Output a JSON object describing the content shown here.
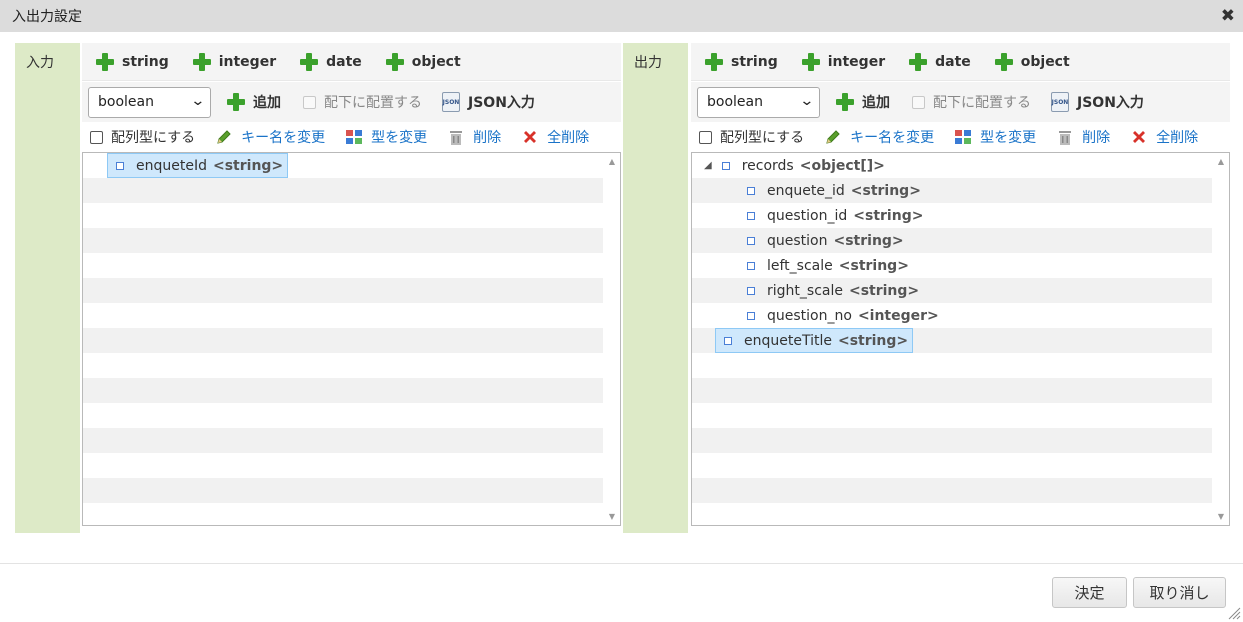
{
  "dialog": {
    "title": "入出力設定",
    "close_glyph": "✖"
  },
  "input_panel": {
    "label": "入力",
    "type_buttons": [
      "string",
      "integer",
      "date",
      "object"
    ],
    "type_select": "boolean",
    "add_label": "追加",
    "child_checkbox_label": "配下に配置する",
    "json_label": "JSON入力",
    "array_checkbox_label": "配列型にする",
    "rename_label": "キー名を変更",
    "change_type_label": "型を変更",
    "delete_label": "削除",
    "delete_all_label": "全削除",
    "tree": [
      {
        "name": "enqueteId",
        "type": "<string>",
        "selected": true
      }
    ]
  },
  "output_panel": {
    "label": "出力",
    "type_buttons": [
      "string",
      "integer",
      "date",
      "object"
    ],
    "type_select": "boolean",
    "add_label": "追加",
    "child_checkbox_label": "配下に配置する",
    "json_label": "JSON入力",
    "array_checkbox_label": "配列型にする",
    "rename_label": "キー名を変更",
    "change_type_label": "型を変更",
    "delete_label": "削除",
    "delete_all_label": "全削除",
    "tree": [
      {
        "name": "records",
        "type": "<object[]>",
        "expanded": true
      },
      {
        "name": "enquete_id",
        "type": "<string>"
      },
      {
        "name": "question_id",
        "type": "<string>"
      },
      {
        "name": "question",
        "type": "<string>"
      },
      {
        "name": "left_scale",
        "type": "<string>"
      },
      {
        "name": "right_scale",
        "type": "<string>"
      },
      {
        "name": "question_no",
        "type": "<integer>"
      },
      {
        "name": "enqueteTitle",
        "type": "<string>",
        "selected": true
      }
    ]
  },
  "footer": {
    "ok_label": "決定",
    "cancel_label": "取り消し"
  },
  "colors": {
    "panel_label_bg": "#ddeac7",
    "plus_green": "#3ba12c",
    "link_blue": "#1a73c8",
    "selection_bg": "#cfe8fc"
  }
}
